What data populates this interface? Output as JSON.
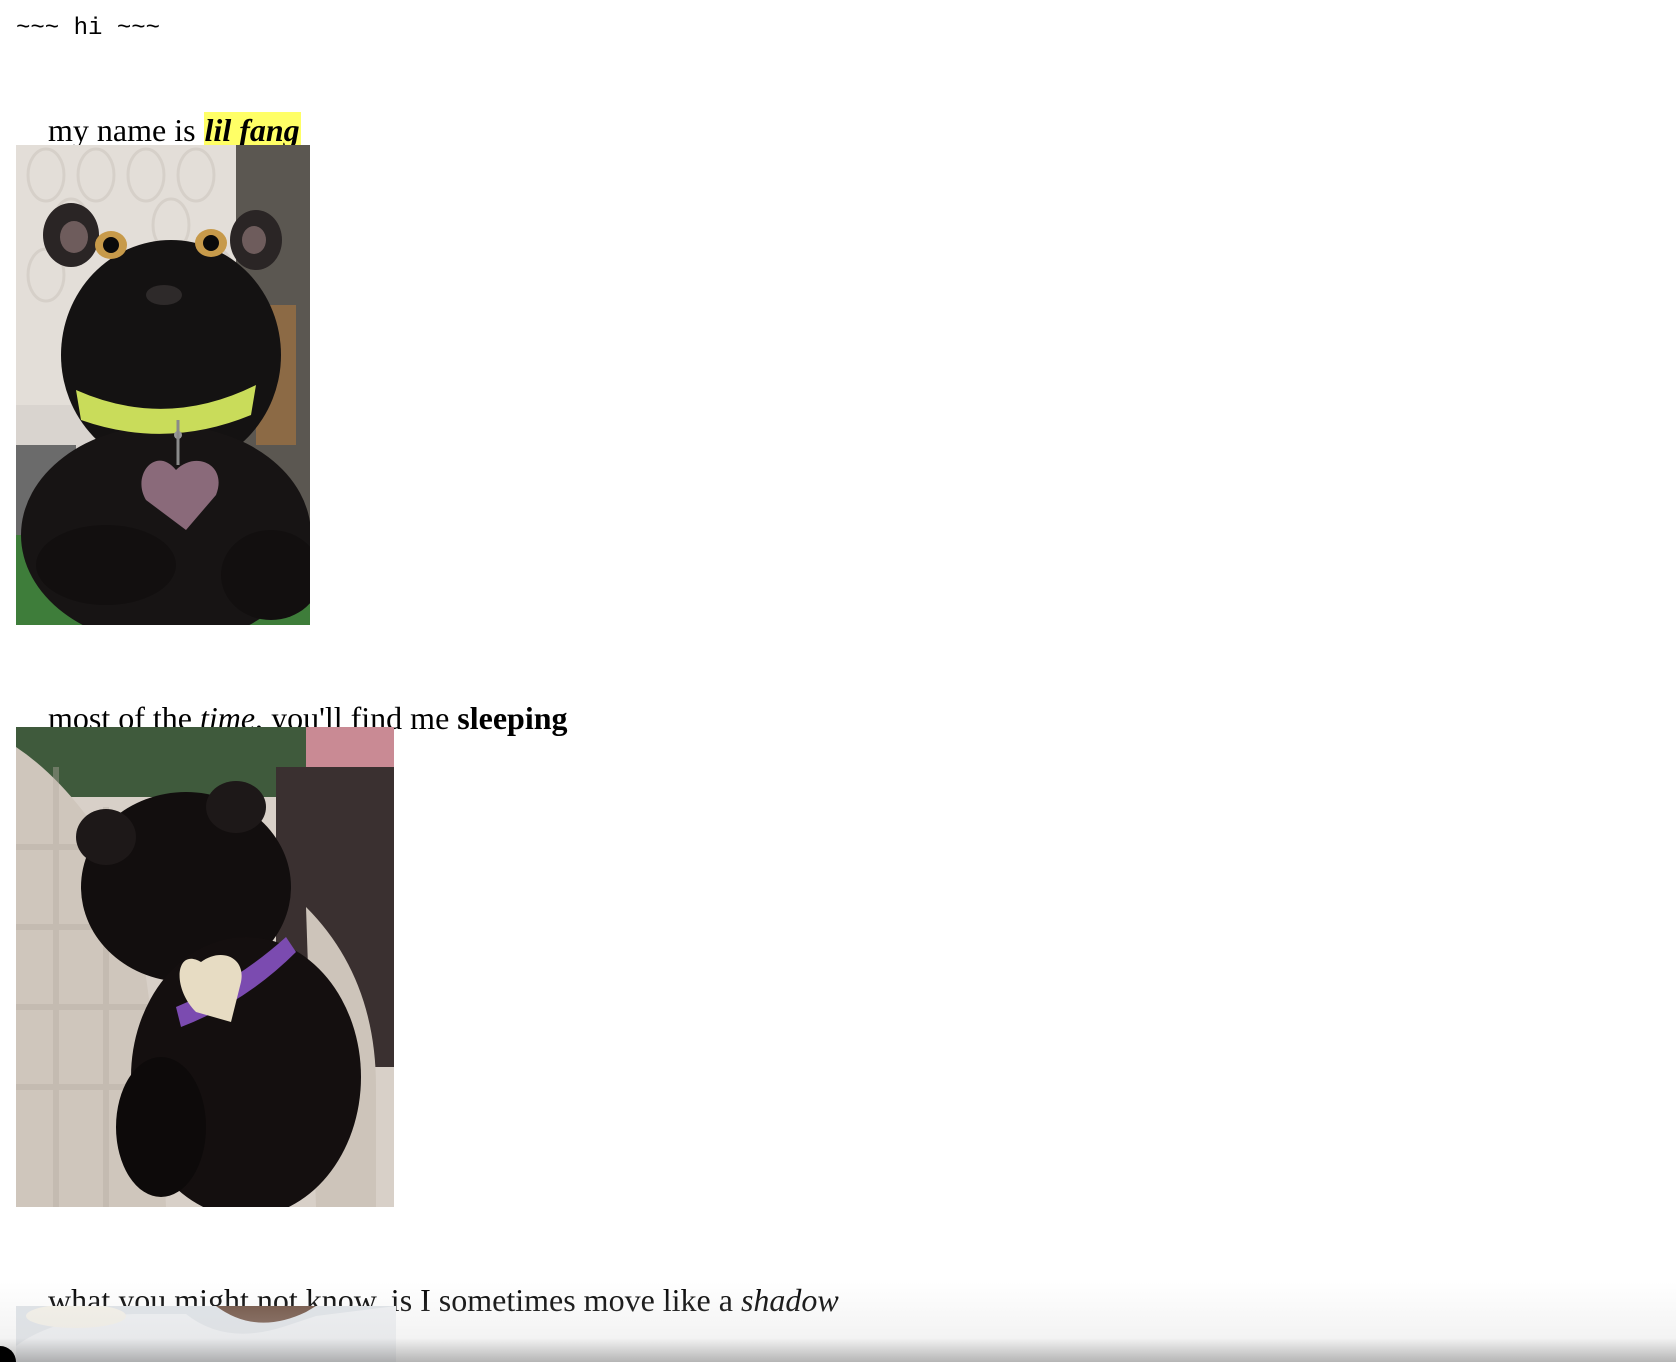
{
  "greeting": "~~~ hi ~~~",
  "intro": {
    "prefix": "my name is ",
    "name": "lil fang"
  },
  "photo1": {
    "alt": "black cat with green collar and heart tag looking up"
  },
  "sleep_line": {
    "part1": "most of the ",
    "em": "time",
    "part2": ", you'll find me ",
    "strong": "sleeping"
  },
  "photo2": {
    "alt": "black cat sleeping on blanket with purple collar"
  },
  "shadow_line": {
    "part1": "what you might not know, is I sometimes move like a ",
    "em": "shadow"
  },
  "photo3": {
    "alt": "partial photo at bottom edge"
  },
  "colors": {
    "highlight": "#ffff66",
    "grass": "#3e7d3a",
    "collar_green": "#c9dc5a",
    "collar_purple": "#7b4bb0"
  }
}
